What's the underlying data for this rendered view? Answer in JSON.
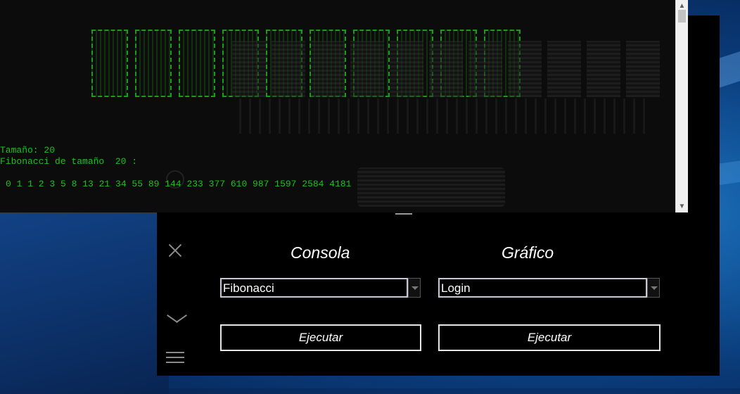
{
  "console": {
    "lines": [
      "Tamaño: 20",
      "Fibonacci de tamaño  20 :",
      "0 1 1 2 3 5 8 13 21 34 55 89 144 233 377 610 987 1597 2584 4181"
    ]
  },
  "launcher": {
    "console_heading": "Consola",
    "graphic_heading": "Gráfico",
    "console_select_value": "Fibonacci",
    "graphic_select_value": "Login",
    "run_console_label": "Ejecutar",
    "run_graphic_label": "Ejecutar"
  },
  "colors": {
    "console_text": "#1cc21c",
    "panel_bg": "#000000"
  }
}
